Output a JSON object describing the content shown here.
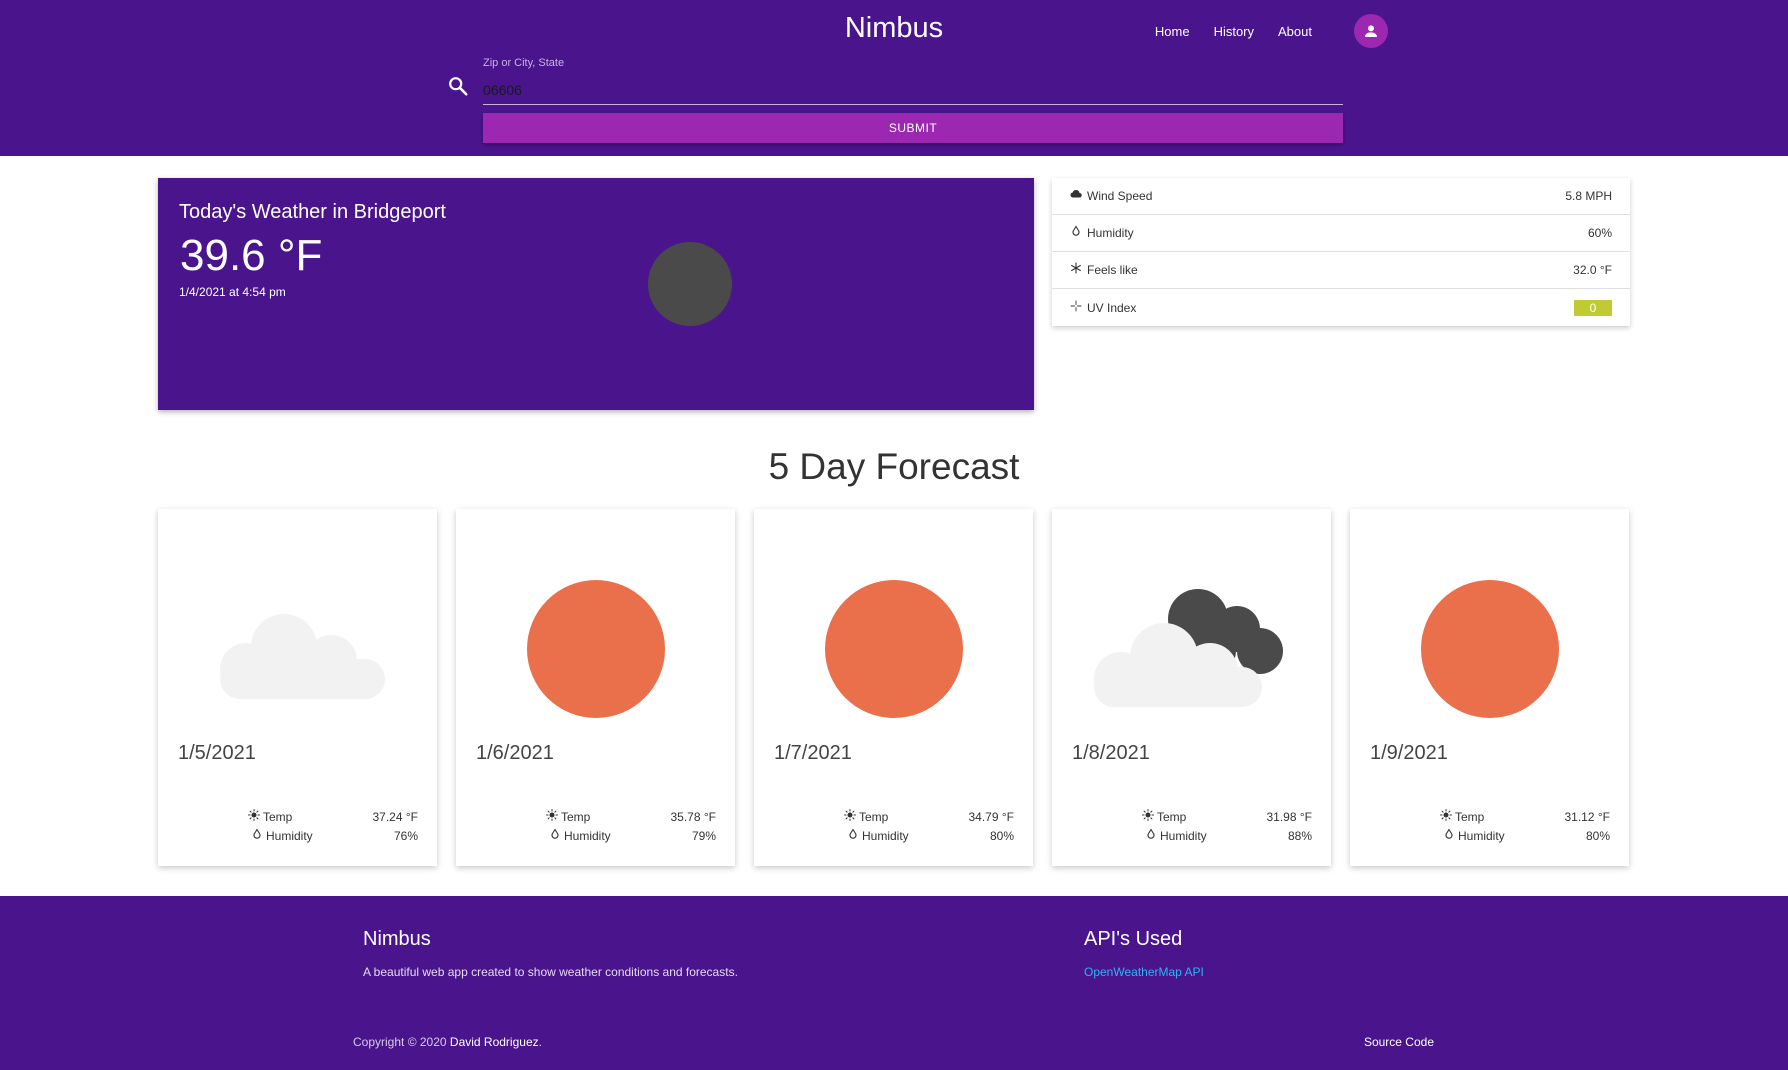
{
  "header": {
    "title": "Nimbus",
    "nav": [
      "Home",
      "History",
      "About"
    ],
    "search": {
      "label": "Zip or City, State",
      "value": "06606"
    },
    "submit_label": "SUBMIT"
  },
  "today": {
    "title": "Today's Weather in Bridgeport",
    "temp": "39.6 °F",
    "time": "1/4/2021 at 4:54 pm",
    "icon": "dark-circle"
  },
  "details": [
    {
      "icon": "cloud-icon",
      "label": "Wind Speed",
      "value": "5.8 MPH"
    },
    {
      "icon": "drop-icon",
      "label": "Humidity",
      "value": "60%"
    },
    {
      "icon": "snowflake-icon",
      "label": "Feels like",
      "value": "32.0 °F"
    },
    {
      "icon": "sparkle-icon",
      "label": "UV Index",
      "value": "0",
      "color": "#c0ca33"
    }
  ],
  "forecast": {
    "title": "5 Day Forecast",
    "temp_label": "Temp",
    "humidity_label": "Humidity",
    "days": [
      {
        "date": "1/5/2021",
        "temp": "37.24 °F",
        "humidity": "76%",
        "icon": "cloud"
      },
      {
        "date": "1/6/2021",
        "temp": "35.78 °F",
        "humidity": "79%",
        "icon": "sun"
      },
      {
        "date": "1/7/2021",
        "temp": "34.79 °F",
        "humidity": "80%",
        "icon": "sun"
      },
      {
        "date": "1/8/2021",
        "temp": "31.98 °F",
        "humidity": "88%",
        "icon": "clouds"
      },
      {
        "date": "1/9/2021",
        "temp": "31.12 °F",
        "humidity": "80%",
        "icon": "sun"
      }
    ]
  },
  "footer": {
    "title": "Nimbus",
    "description": "A beautiful web app created to show weather conditions and forecasts.",
    "api_title": "API's Used",
    "api_link": "OpenWeatherMap API",
    "copyright_prefix": "Copyright © 2020",
    "author": "David Rodriguez",
    "source_label": "Source Code"
  },
  "colors": {
    "primary": "#4a148c",
    "accent": "#9c27b0",
    "sun": "#ea6f4b",
    "uv_low": "#c0ca33"
  }
}
